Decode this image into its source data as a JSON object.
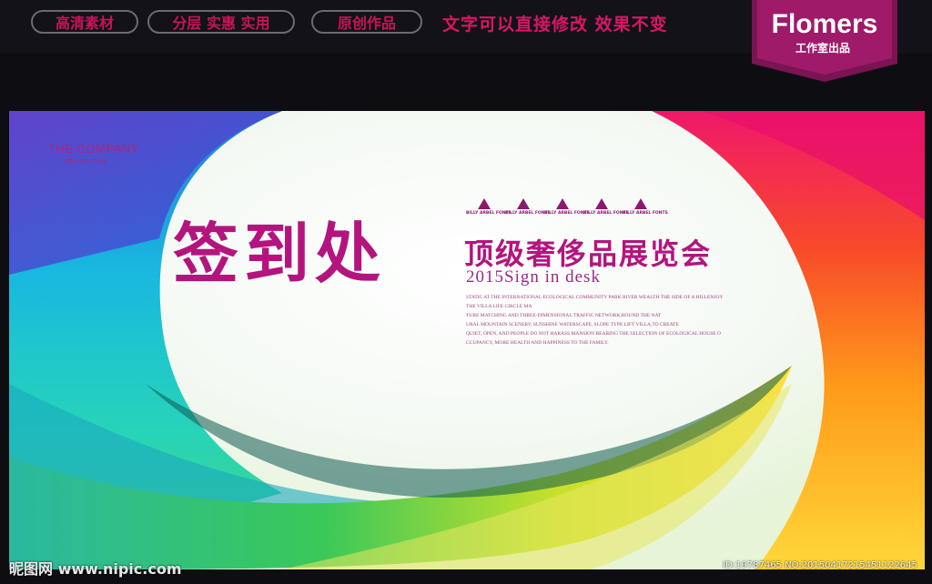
{
  "topbar": {
    "pills": [
      "高清素材",
      "分层 实惠 实用",
      "原创作品"
    ],
    "slogan": "文字可以直接修改 效果不变",
    "brand_name": "Flomers",
    "brand_sub": "工作室出品"
  },
  "board": {
    "company_name": "THE COMPANY",
    "company_sub": "请输入您的公司名称",
    "title_main": "签到处",
    "title_sub": "顶级奢侈品展览会",
    "subtitle_en": "2015Sign in desk",
    "stars": [
      "BILLY ARBEL FONTS",
      "BILLY ARBEL FONTS",
      "BILLY ARBEL FONTS",
      "BILLY ARBEL FONTS",
      "BILLY ARBEL FONTS"
    ],
    "description": [
      "STATIC AT THE INTERNATIONAL ECOLOGICAL COMMUNITY PARK RIVER WEALTH THE SIDE OF A HILLENJOY",
      "THE VILLA LIFE CIRCLE MA",
      "TURE MATCHING AND THREE-DIMENSIONAL TRAFFIC NETWORK,ROUND THE NAT",
      "URAL MOUNTAIN SCENERY, SUNSHINE WATERSCAPE, SLOPE TYPE LIFT VILLA,TO CREATE",
      "QUIET, OPEN, AND PEOPLE DO NOT HARASS MANSION BEARING THE SELECTION OF ECOLOGICAL HOUSE O",
      "CCUPANCY, MORE HEALTH AND HAPPINESS TO THE FAMILY."
    ]
  },
  "footer": {
    "watermark": "昵图网 www.nipic.com",
    "id_text": "ID:19787465 NO:20150417215451122645"
  },
  "colors": {
    "accent": "#b4147e",
    "slogan": "#d81763",
    "badge": "#7a1452"
  }
}
